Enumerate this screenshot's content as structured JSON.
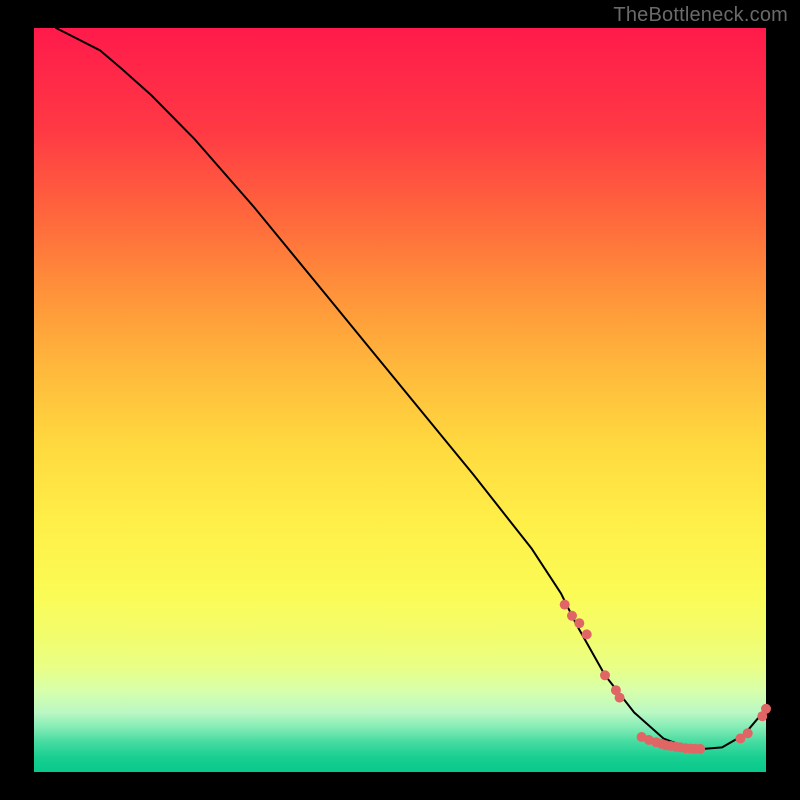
{
  "watermark": "TheBottleneck.com",
  "chart_data": {
    "type": "line",
    "title": "",
    "xlabel": "",
    "ylabel": "",
    "xlim": [
      0,
      100
    ],
    "ylim": [
      0,
      100
    ],
    "grid": false,
    "legend": null,
    "series": [
      {
        "name": "curve",
        "style": "line",
        "color": "#000000",
        "x": [
          3,
          5,
          9,
          12,
          16,
          22,
          30,
          40,
          50,
          60,
          68,
          72,
          74,
          78,
          82,
          86,
          90,
          94,
          97,
          100
        ],
        "y": [
          100,
          99,
          97,
          94.5,
          91,
          85,
          76,
          64,
          52,
          40,
          30,
          24,
          20,
          13,
          8,
          4.5,
          3,
          3.3,
          5,
          8.5
        ]
      },
      {
        "name": "markers-upper",
        "style": "scatter",
        "color": "#e06666",
        "x": [
          72.5,
          73.5,
          74.5,
          75.5,
          78.0,
          79.5,
          80.0
        ],
        "y": [
          22.5,
          21.0,
          20.0,
          18.5,
          13.0,
          11.0,
          10.0
        ]
      },
      {
        "name": "markers-lower",
        "style": "scatter",
        "color": "#e06666",
        "x": [
          83.0,
          84.0,
          85.0,
          85.7,
          86.3,
          87.0,
          87.7,
          88.3,
          89.0,
          89.7,
          90.3,
          91.0
        ],
        "y": [
          4.7,
          4.3,
          4.0,
          3.8,
          3.6,
          3.5,
          3.4,
          3.3,
          3.2,
          3.15,
          3.1,
          3.1
        ]
      },
      {
        "name": "markers-tail",
        "style": "scatter",
        "color": "#e06666",
        "x": [
          96.5,
          97.5,
          99.5,
          100.0
        ],
        "y": [
          4.5,
          5.2,
          7.5,
          8.5
        ]
      }
    ]
  }
}
